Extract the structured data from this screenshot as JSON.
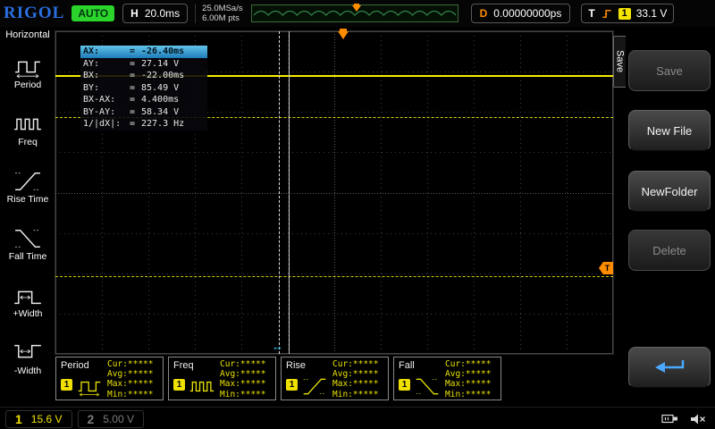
{
  "topbar": {
    "logo": "RIGOL",
    "status": "AUTO",
    "horizontal": {
      "label": "H",
      "value": "20.0ms"
    },
    "sample_rate": "25.0MSa/s",
    "mem_depth": "6.00M pts",
    "delay": {
      "label": "D",
      "value": "0.00000000ps"
    },
    "trigger": {
      "label": "T",
      "channel": "1",
      "level": "33.1 V"
    }
  },
  "sidebar": {
    "title": "Horizontal",
    "items": [
      {
        "label": "Period",
        "icon": "period-icon"
      },
      {
        "label": "Freq",
        "icon": "freq-icon"
      },
      {
        "label": "Rise Time",
        "icon": "rise-time-icon"
      },
      {
        "label": "Fall Time",
        "icon": "fall-time-icon"
      },
      {
        "label": "+Width",
        "icon": "plus-width-icon"
      },
      {
        "label": "-Width",
        "icon": "minus-width-icon"
      }
    ]
  },
  "cursor_panel": {
    "eq": "=",
    "rows": [
      {
        "label": "AX:",
        "value": "-26.40ms",
        "highlight": true
      },
      {
        "label": "AY:",
        "value": "27.14 V"
      },
      {
        "label": "BX:",
        "value": "-22.00ms"
      },
      {
        "label": "BY:",
        "value": "85.49 V"
      },
      {
        "label": "BX-AX:",
        "value": "4.400ms"
      },
      {
        "label": "BY-AY:",
        "value": "58.34 V"
      },
      {
        "label": "1/|dX|:",
        "value": "227.3 Hz"
      }
    ]
  },
  "markers": {
    "cursor_marker": "↔"
  },
  "menu": {
    "tab": "Save",
    "buttons": [
      {
        "name": "save-button",
        "label": "Save",
        "enabled": false
      },
      {
        "name": "new-file-button",
        "label": "New File",
        "enabled": true
      },
      {
        "name": "new-folder-button",
        "label": "NewFolder",
        "enabled": true
      },
      {
        "name": "delete-button",
        "label": "Delete",
        "enabled": false
      },
      {
        "name": "return-button",
        "label": "",
        "icon": "return-arrow-icon",
        "enabled": true
      }
    ]
  },
  "measurements": [
    {
      "label": "Period",
      "channel": "1",
      "icon": "period-icon",
      "stats": [
        {
          "label": "Cur:",
          "value": "*****"
        },
        {
          "label": "Avg:",
          "value": "*****"
        },
        {
          "label": "Max:",
          "value": "*****"
        },
        {
          "label": "Min:",
          "value": "*****"
        }
      ]
    },
    {
      "label": "Freq",
      "channel": "1",
      "icon": "freq-icon",
      "stats": [
        {
          "label": "Cur:",
          "value": "*****"
        },
        {
          "label": "Avg:",
          "value": "*****"
        },
        {
          "label": "Max:",
          "value": "*****"
        },
        {
          "label": "Min:",
          "value": "*****"
        }
      ]
    },
    {
      "label": "Rise",
      "channel": "1",
      "icon": "rise-time-icon",
      "stats": [
        {
          "label": "Cur:",
          "value": "*****"
        },
        {
          "label": "Avg:",
          "value": "*****"
        },
        {
          "label": "Max:",
          "value": "*****"
        },
        {
          "label": "Min:",
          "value": "*****"
        }
      ]
    },
    {
      "label": "Fall",
      "channel": "1",
      "icon": "fall-time-icon",
      "stats": [
        {
          "label": "Cur:",
          "value": "*****"
        },
        {
          "label": "Avg:",
          "value": "*****"
        },
        {
          "label": "Max:",
          "value": "*****"
        },
        {
          "label": "Min:",
          "value": "*****"
        }
      ]
    }
  ],
  "statusbar": {
    "ch1": {
      "number": "1",
      "scale": "15.6 V"
    },
    "ch2": {
      "number": "2",
      "scale": "5.00 V"
    }
  },
  "colors": {
    "channel1_yellow": "#f5e400",
    "channel2_gray": "#7c7c7c",
    "trigger_orange": "#ff8c00",
    "run_status_green": "#2bd42b",
    "logo_blue": "#2a6fe0",
    "cursor_highlight_blue": "#3aa0d8",
    "cursor_marker_cyan": "#35c8f5"
  }
}
